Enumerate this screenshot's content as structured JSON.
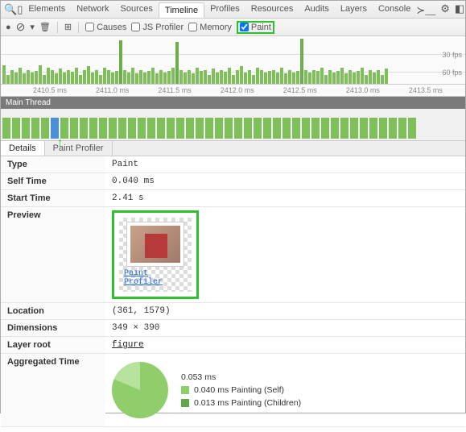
{
  "nav": {
    "tabs": [
      "Elements",
      "Network",
      "Sources",
      "Timeline",
      "Profiles",
      "Resources",
      "Audits",
      "Layers",
      "Console"
    ],
    "selected": "Timeline"
  },
  "toolbar": {
    "causes": "Causes",
    "jsprofiler": "JS Profiler",
    "memory": "Memory",
    "paint": "Paint"
  },
  "fps": {
    "a": "30 fps",
    "b": "60 fps"
  },
  "ticks": [
    "2410.5 ms",
    "2411.0 ms",
    "2411.5 ms",
    "2412.0 ms",
    "2412.5 ms",
    "2413.0 ms",
    "2413.5 ms"
  ],
  "thread_header": "Main Thread",
  "detail_tabs": {
    "details": "Details",
    "profiler": "Paint Profiler"
  },
  "rows": {
    "type_k": "Type",
    "type_v": "Paint",
    "self_k": "Self Time",
    "self_v": "0.040 ms",
    "start_k": "Start Time",
    "start_v": "2.41 s",
    "preview_k": "Preview",
    "paint_profiler_link": "Paint Profiler",
    "location_k": "Location",
    "location_v": "(361, 1579)",
    "dim_k": "Dimensions",
    "dim_v": "349 × 390",
    "layer_k": "Layer root",
    "layer_v": "figure",
    "agg_k": "Aggregated Time",
    "agg_total": "0.053 ms",
    "agg_self": "0.040 ms Painting (Self)",
    "agg_children": "0.013 ms Painting (Children)"
  },
  "colors": {
    "self": "#8fce6b",
    "children": "#5ea848"
  },
  "chart_data": {
    "type": "pie",
    "title": "Aggregated Time",
    "unit": "ms",
    "total": 0.053,
    "series": [
      {
        "name": "Painting (Self)",
        "value": 0.04,
        "color": "#8fce6b"
      },
      {
        "name": "Painting (Children)",
        "value": 0.013,
        "color": "#5ea848"
      }
    ]
  }
}
